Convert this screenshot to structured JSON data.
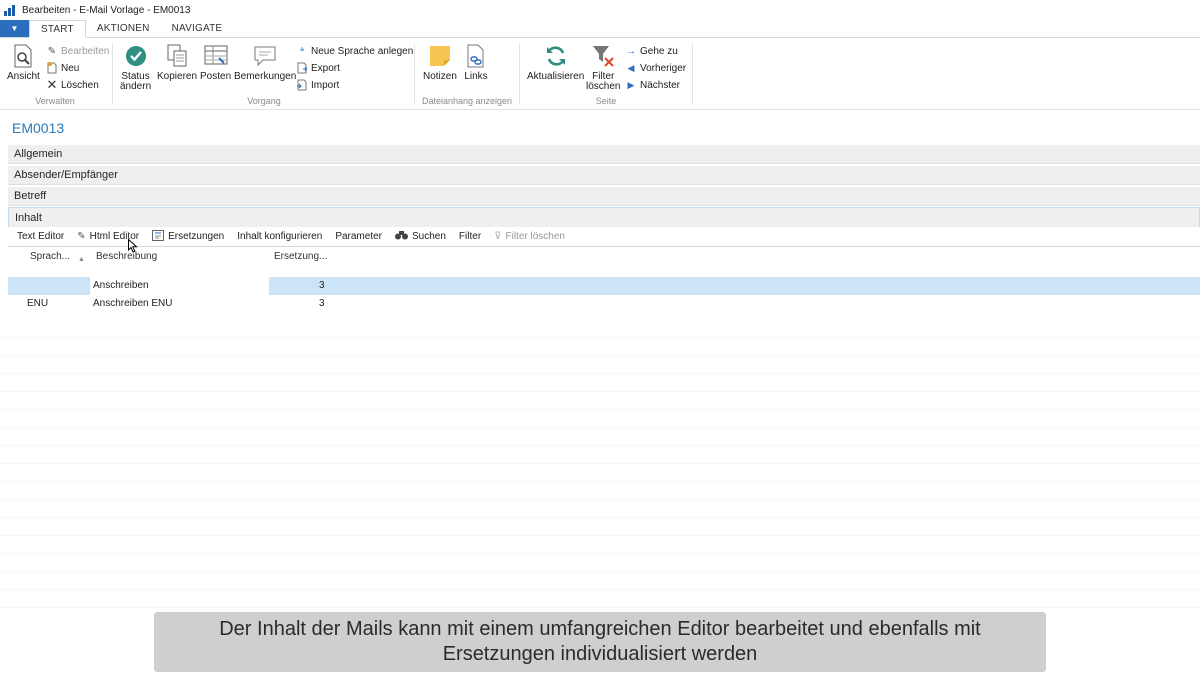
{
  "window": {
    "title": "Bearbeiten - E-Mail Vorlage - EM0013"
  },
  "tabs": [
    {
      "label": "START",
      "active": true
    },
    {
      "label": "AKTIONEN",
      "active": false
    },
    {
      "label": "NAVIGATE",
      "active": false
    }
  ],
  "ribbon": {
    "verwalten": {
      "label": "Verwalten",
      "ansicht": "Ansicht",
      "bearbeiten": "Bearbeiten",
      "neu": "Neu",
      "loeschen": "Löschen"
    },
    "vorgang": {
      "label": "Vorgang",
      "status_line1": "Status",
      "status_line2": "ändern",
      "kopieren": "Kopieren",
      "posten": "Posten",
      "bemerkungen": "Bemerkungen",
      "neue_sprache": "Neue Sprache anlegen",
      "export": "Export",
      "import": "Import"
    },
    "dateianhang": {
      "label": "Dateianhang anzeigen",
      "notizen": "Notizen",
      "links": "Links"
    },
    "seite": {
      "label": "Seite",
      "aktualisieren": "Aktualisieren",
      "filter_line1": "Filter",
      "filter_line2": "löschen",
      "gehe_zu": "Gehe zu",
      "vorheriger": "Vorheriger",
      "naechster": "Nächster"
    }
  },
  "record": {
    "title": "EM0013"
  },
  "sections": {
    "allgemein": "Allgemein",
    "absender": "Absender/Empfänger",
    "betreff": "Betreff",
    "inhalt": "Inhalt"
  },
  "subpage_toolbar": {
    "text_editor": "Text Editor",
    "html_editor": "Html Editor",
    "ersetzungen": "Ersetzungen",
    "inhalt_konfigurieren": "Inhalt konfigurieren",
    "parameter": "Parameter",
    "suchen": "Suchen",
    "filter": "Filter",
    "filter_loeschen": "Filter löschen"
  },
  "table": {
    "columns": [
      "Sprach...",
      "Beschreibung",
      "Ersetzung..."
    ],
    "rows": [
      {
        "sprache": "",
        "beschreibung": "Anschreiben",
        "ersetzung": "3",
        "selected": true
      },
      {
        "sprache": "ENU",
        "beschreibung": "Anschreiben ENU",
        "ersetzung": "3",
        "selected": false
      }
    ]
  },
  "caption": {
    "line1": "Der Inhalt der Mails kann mit einem umfangreichen Editor bearbeitet und ebenfalls mit",
    "line2": "Ersetzungen individualisiert werden"
  },
  "colors": {
    "accent": "#2a6ebd",
    "record_title": "#2a7ab8",
    "selected_row": "#cce4f7",
    "section_bg": "#efefef"
  }
}
